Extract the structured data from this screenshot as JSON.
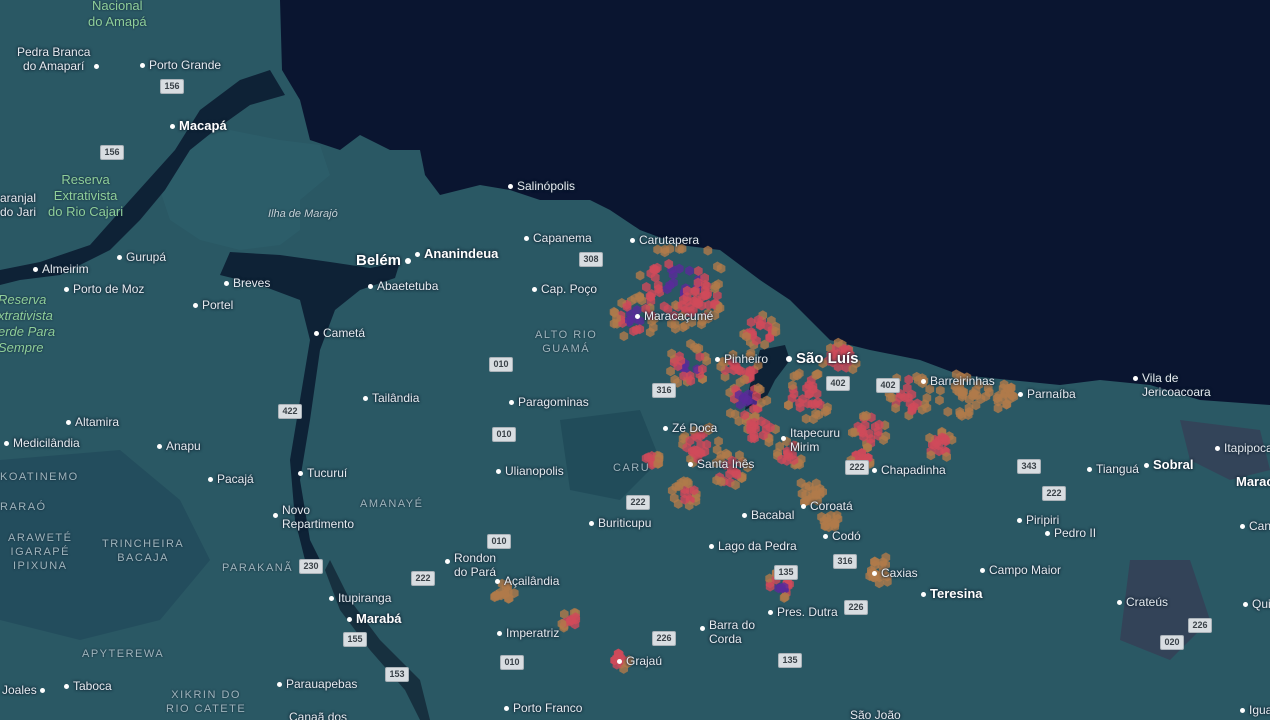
{
  "colors": {
    "ocean": "#0a1530",
    "land": "#2a5864",
    "land_dark": "#1f4551",
    "river": "#0e2236",
    "heat_low": "#b07a4a",
    "heat_mid": "#d04a5a",
    "heat_high": "#5a2a9a"
  },
  "cities": [
    {
      "name": "Belém",
      "size": "big",
      "dot": "right"
    },
    {
      "name": "Ananindeua",
      "size": "mid"
    },
    {
      "name": "Macapá",
      "size": "mid"
    },
    {
      "name": "São Luís",
      "size": "big"
    },
    {
      "name": "Teresina",
      "size": "mid"
    },
    {
      "name": "Marabá",
      "size": "mid"
    },
    {
      "name": "Sobral",
      "size": "mid"
    },
    {
      "name": "Salinópolis"
    },
    {
      "name": "Capanema"
    },
    {
      "name": "Carutapera"
    },
    {
      "name": "Cap. Poço"
    },
    {
      "name": "Maracaçumé"
    },
    {
      "name": "Pinheiro"
    },
    {
      "name": "Barreirinhas"
    },
    {
      "name": "Parnaíba"
    },
    {
      "name": "Vila de\nJericoacoara"
    },
    {
      "name": "Abaetetuba"
    },
    {
      "name": "Breves"
    },
    {
      "name": "Portel"
    },
    {
      "name": "Cametá"
    },
    {
      "name": "Gurupá"
    },
    {
      "name": "Almeirim"
    },
    {
      "name": "Porto de Moz"
    },
    {
      "name": "Porto Grande"
    },
    {
      "name": "Pedra Branca\ndo Amaparí",
      "dot": "right"
    },
    {
      "name": "Tailândia"
    },
    {
      "name": "Paragominas"
    },
    {
      "name": "Altamira"
    },
    {
      "name": "Medicilândia"
    },
    {
      "name": "Anapu"
    },
    {
      "name": "Pacajá"
    },
    {
      "name": "Tucuruí"
    },
    {
      "name": "Novo\nRepartimento"
    },
    {
      "name": "Ulianopolis"
    },
    {
      "name": "Zé Doca"
    },
    {
      "name": "Santa Inês"
    },
    {
      "name": "Itapecuru\nMirim"
    },
    {
      "name": "Chapadinha"
    },
    {
      "name": "Tianguá"
    },
    {
      "name": "Itapipoca"
    },
    {
      "name": "Buriticupu"
    },
    {
      "name": "Bacabal"
    },
    {
      "name": "Coroatá"
    },
    {
      "name": "Codó"
    },
    {
      "name": "Lago da Pedra"
    },
    {
      "name": "Piripiri"
    },
    {
      "name": "Pedro II"
    },
    {
      "name": "Rondon\ndo Pará",
      "dot": "below"
    },
    {
      "name": "Açailândia"
    },
    {
      "name": "Caxias"
    },
    {
      "name": "Campo Maior"
    },
    {
      "name": "Itupiranga"
    },
    {
      "name": "Imperatriz"
    },
    {
      "name": "Pres. Dutra"
    },
    {
      "name": "Barra do\nCorda"
    },
    {
      "name": "Crateús"
    },
    {
      "name": "Grajaú"
    },
    {
      "name": "Parauapebas"
    },
    {
      "name": "Taboca"
    },
    {
      "name": "Joales",
      "dot": "right"
    },
    {
      "name": "Porto Franco"
    },
    {
      "name": "Canaã dos"
    },
    {
      "name": "São João"
    },
    {
      "name": "aranjal\ndo Jari",
      "dot": "none"
    },
    {
      "name": "Marac",
      "size": "mid"
    },
    {
      "name": "Can"
    },
    {
      "name": "Quix"
    },
    {
      "name": "Iguat"
    }
  ],
  "parks": [
    {
      "name": "Nacional\ndo Amapá"
    },
    {
      "name": "Reserva\nExtrativista\ndo Rio Cajari"
    },
    {
      "name": "Reserva\nxtrativista\nerde Para\nSempre",
      "italic": true
    }
  ],
  "areas": [
    "ALTO RIO\nGUAMÁ",
    "CARU",
    "AMANAYÉ",
    "KOATINEMO",
    "ARAWETÉ\nIGARAPÉ\nIPIXUNA",
    "TRINCHEIRA\nBACAJA",
    "PARAKANÃ",
    "APYTEREWA",
    "XIKRIN DO\nRIO CATETE",
    "RARAÓ"
  ],
  "islands": [
    "Ilha de Marajó"
  ],
  "road_shields": [
    "156",
    "156",
    "308",
    "316",
    "010",
    "422",
    "010",
    "402",
    "402",
    "222",
    "343",
    "222",
    "222",
    "010",
    "230",
    "222",
    "135",
    "316",
    "155",
    "226",
    "226",
    "020",
    "153",
    "010",
    "135",
    "226"
  ]
}
